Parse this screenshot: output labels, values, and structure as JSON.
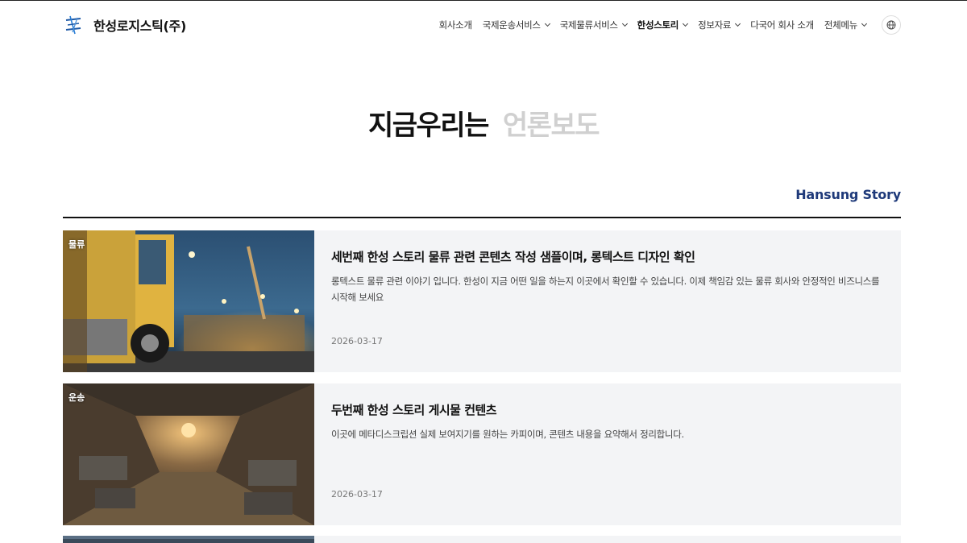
{
  "header": {
    "brand": "한성로지스틱(주)",
    "nav": [
      {
        "label": "회사소개",
        "dropdown": false,
        "active": false
      },
      {
        "label": "국제운송서비스",
        "dropdown": true,
        "active": false
      },
      {
        "label": "국제물류서비스",
        "dropdown": true,
        "active": false
      },
      {
        "label": "한성스토리",
        "dropdown": true,
        "active": true
      },
      {
        "label": "정보자료",
        "dropdown": true,
        "active": false
      },
      {
        "label": "다국어 회사 소개",
        "dropdown": false,
        "active": false
      },
      {
        "label": "전체메뉴",
        "dropdown": true,
        "active": false
      }
    ],
    "language_icon": "globe-icon"
  },
  "hero": {
    "title_main": "지금우리는",
    "title_sub": "언론보도"
  },
  "section": {
    "label": "Hansung Story"
  },
  "posts": [
    {
      "category": "물류",
      "title": "세번째 한성 스토리 물류 관련 콘텐츠 작성 샘플이며, 롱텍스트 디자인 확인",
      "description": "롱텍스트 물류 관련 이야기 입니다. 한성이 지금 어떤 일을 하는지 이곳에서 확인할 수 있습니다. 이제 책임감 있는 물류 회사와 안정적인 비즈니스를 시작해 보세요",
      "date": "2026-03-17"
    },
    {
      "category": "운송",
      "title": "두번째 한성 스토리 게시물 컨텐츠",
      "description": "이곳에 메타디스크립션 실제 보여지기를 원하는 카피이며, 콘텐츠 내용을 요약해서 정리합니다.",
      "date": "2026-03-17"
    }
  ],
  "colors": {
    "accent": "#1f3a7a",
    "card_bg": "#f3f4f6",
    "muted_title": "#d0d0d0"
  }
}
